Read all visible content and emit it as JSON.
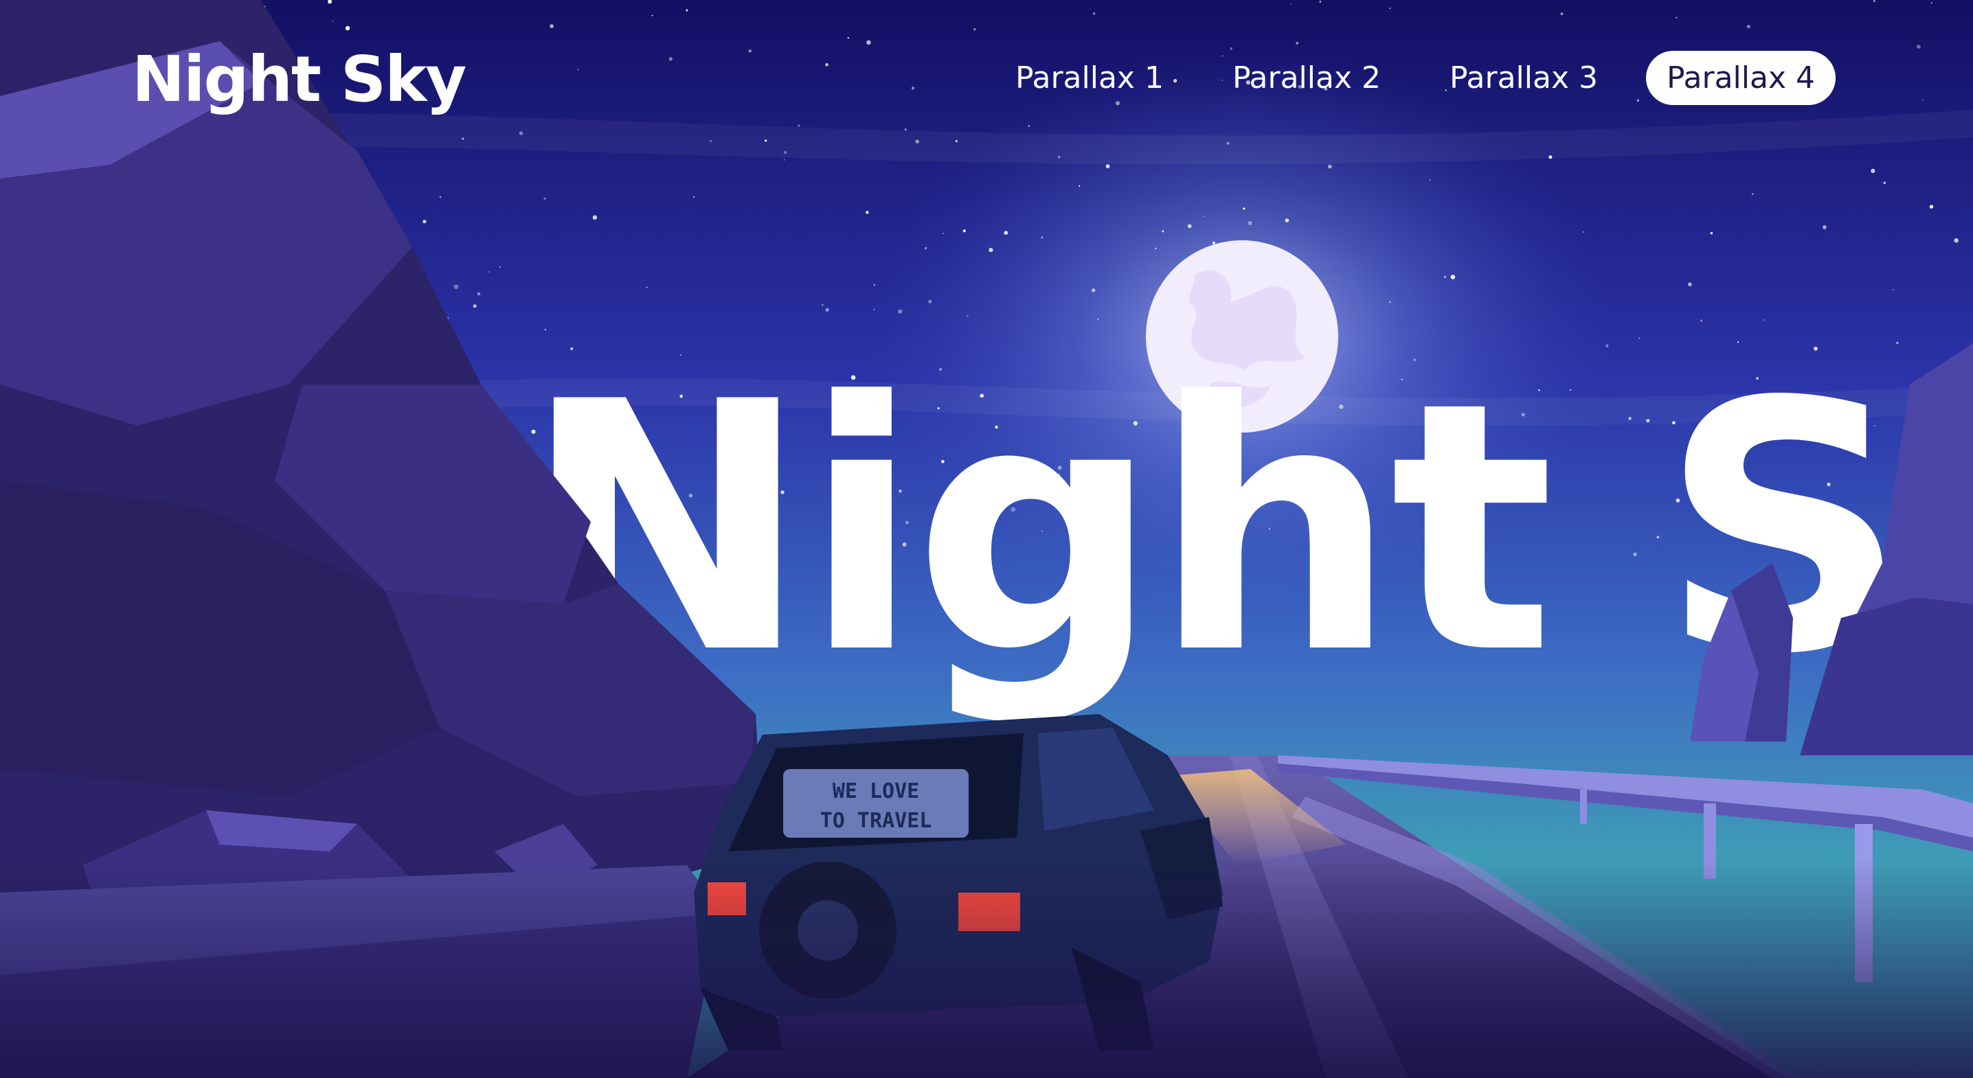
{
  "brand": {
    "logo": "Night Sky"
  },
  "nav": {
    "items": [
      {
        "label": "Parallax 1"
      },
      {
        "label": "Parallax 2"
      },
      {
        "label": "Parallax 3"
      },
      {
        "label": "Parallax 4",
        "active": true
      }
    ]
  },
  "hero": {
    "title": "Night Sky"
  },
  "car": {
    "plate_line1": "WE LOVE",
    "plate_line2": "TO TRAVEL"
  },
  "colors": {
    "sky_top": "#14106a",
    "sky_mid": "#3a4fc2",
    "horizon": "#3fa0b8",
    "rock": "#3b2f7a",
    "road": "#5a4fa0",
    "car": "#1d2a5a",
    "taillight": "#ff4a3a",
    "moon": "#f2eefe"
  }
}
